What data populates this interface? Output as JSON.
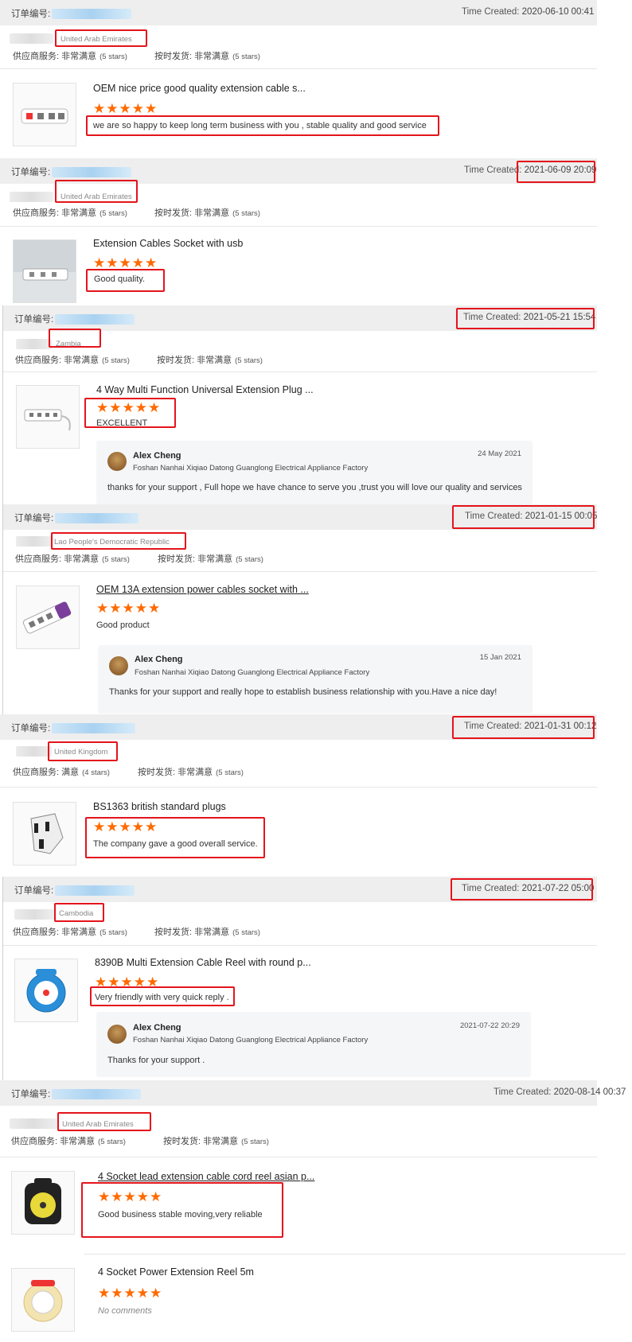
{
  "labels": {
    "order_no": "订单编号:",
    "time_created": "Time Created:",
    "supplier_service": "供应商服务:",
    "on_time_delivery": "按时发货:"
  },
  "ratings": {
    "very_satisfied": "非常满意",
    "satisfied": "满意",
    "five_stars": "(5 stars)",
    "four_stars": "(4 stars)",
    "stars_glyph": "★★★★★"
  },
  "orders": [
    {
      "time": "2020-06-10 00:41",
      "country": "United Arab Emirates",
      "supplier_rating": "非常满意",
      "supplier_stars": "(5 stars)",
      "delivery_rating": "非常满意",
      "delivery_stars": "(5 stars)",
      "products": [
        {
          "name": "OEM nice price good quality extension cable s...",
          "thumb_icon": "power-strip-icon",
          "rating": 5,
          "comment": "we are so happy to keep long term business with you , stable quality and good service"
        }
      ]
    },
    {
      "time": "2021-06-09 20:09",
      "country": "United Arab Emirates",
      "supplier_rating": "非常满意",
      "supplier_stars": "(5 stars)",
      "delivery_rating": "非常满意",
      "delivery_stars": "(5 stars)",
      "products": [
        {
          "name": "Extension Cables Socket with usb",
          "thumb_icon": "usb-socket-icon",
          "rating": 5,
          "comment": "Good quality."
        }
      ]
    },
    {
      "time": "2021-05-21 15:54",
      "country": "Zambia",
      "supplier_rating": "非常满意",
      "supplier_stars": "(5 stars)",
      "delivery_rating": "非常满意",
      "delivery_stars": "(5 stars)",
      "products": [
        {
          "name": "4 Way Multi Function Universal Extension Plug ...",
          "thumb_icon": "power-strip-icon",
          "rating": 5,
          "comment": "EXCELLENT",
          "reply": {
            "name": "Alex Cheng",
            "company": "Foshan Nanhai Xiqiao Datong Guanglong Electrical Appliance Factory",
            "date": "24 May 2021",
            "text": "thanks for your support , Full hope we have chance to serve you ,trust you will love our quality and services"
          }
        }
      ]
    },
    {
      "time": "2021-01-15 00:05",
      "country": "Lao People's Democratic Republic",
      "supplier_rating": "非常满意",
      "supplier_stars": "(5 stars)",
      "delivery_rating": "非常满意",
      "delivery_stars": "(5 stars)",
      "products": [
        {
          "name": "OEM 13A extension power cables socket with ...",
          "thumb_icon": "power-strip-icon",
          "rating": 5,
          "comment": "Good product",
          "reply": {
            "name": "Alex Cheng",
            "company": "Foshan Nanhai Xiqiao Datong Guanglong Electrical Appliance Factory",
            "date": "15 Jan 2021",
            "text": "Thanks for your support and really hope to establish business relationship with you.Have a nice day!"
          }
        }
      ]
    },
    {
      "time": "2021-01-31 00:12",
      "country": "United Kingdom",
      "supplier_rating": "满意",
      "supplier_stars": "(4 stars)",
      "delivery_rating": "非常满意",
      "delivery_stars": "(5 stars)",
      "products": [
        {
          "name": "BS1363 british standard plugs",
          "thumb_icon": "uk-plug-icon",
          "rating": 5,
          "comment": "The company gave a good overall service."
        }
      ]
    },
    {
      "time": "2021-07-22 05:00",
      "country": "Cambodia",
      "supplier_rating": "非常满意",
      "supplier_stars": "(5 stars)",
      "delivery_rating": "非常满意",
      "delivery_stars": "(5 stars)",
      "products": [
        {
          "name": "8390B Multi Extension Cable Reel with round p...",
          "thumb_icon": "cable-reel-icon",
          "rating": 5,
          "comment": "Very friendly with very quick reply .",
          "reply": {
            "name": "Alex Cheng",
            "company": "Foshan Nanhai Xiqiao Datong Guanglong Electrical Appliance Factory",
            "date": "2021-07-22 20:29",
            "text": "Thanks for your support ."
          }
        }
      ]
    },
    {
      "time": "2020-08-14 00:37",
      "country": "United Arab Emirates",
      "supplier_rating": "非常满意",
      "supplier_stars": "(5 stars)",
      "delivery_rating": "非常满意",
      "delivery_stars": "(5 stars)",
      "products": [
        {
          "name": "4 Socket lead extension cable cord reel asian p...",
          "thumb_icon": "cable-reel-icon",
          "rating": 5,
          "comment": "Good business stable moving,very reliable"
        },
        {
          "name": "4 Socket Power Extension Reel 5m",
          "thumb_icon": "cable-reel-icon",
          "rating": 5,
          "comment": "No comments"
        }
      ]
    }
  ],
  "colors": {
    "star": "#ff6a00",
    "highlight_box": "#e4141b",
    "header_bg": "#eeeeee",
    "reply_bg": "#f5f6f7"
  }
}
